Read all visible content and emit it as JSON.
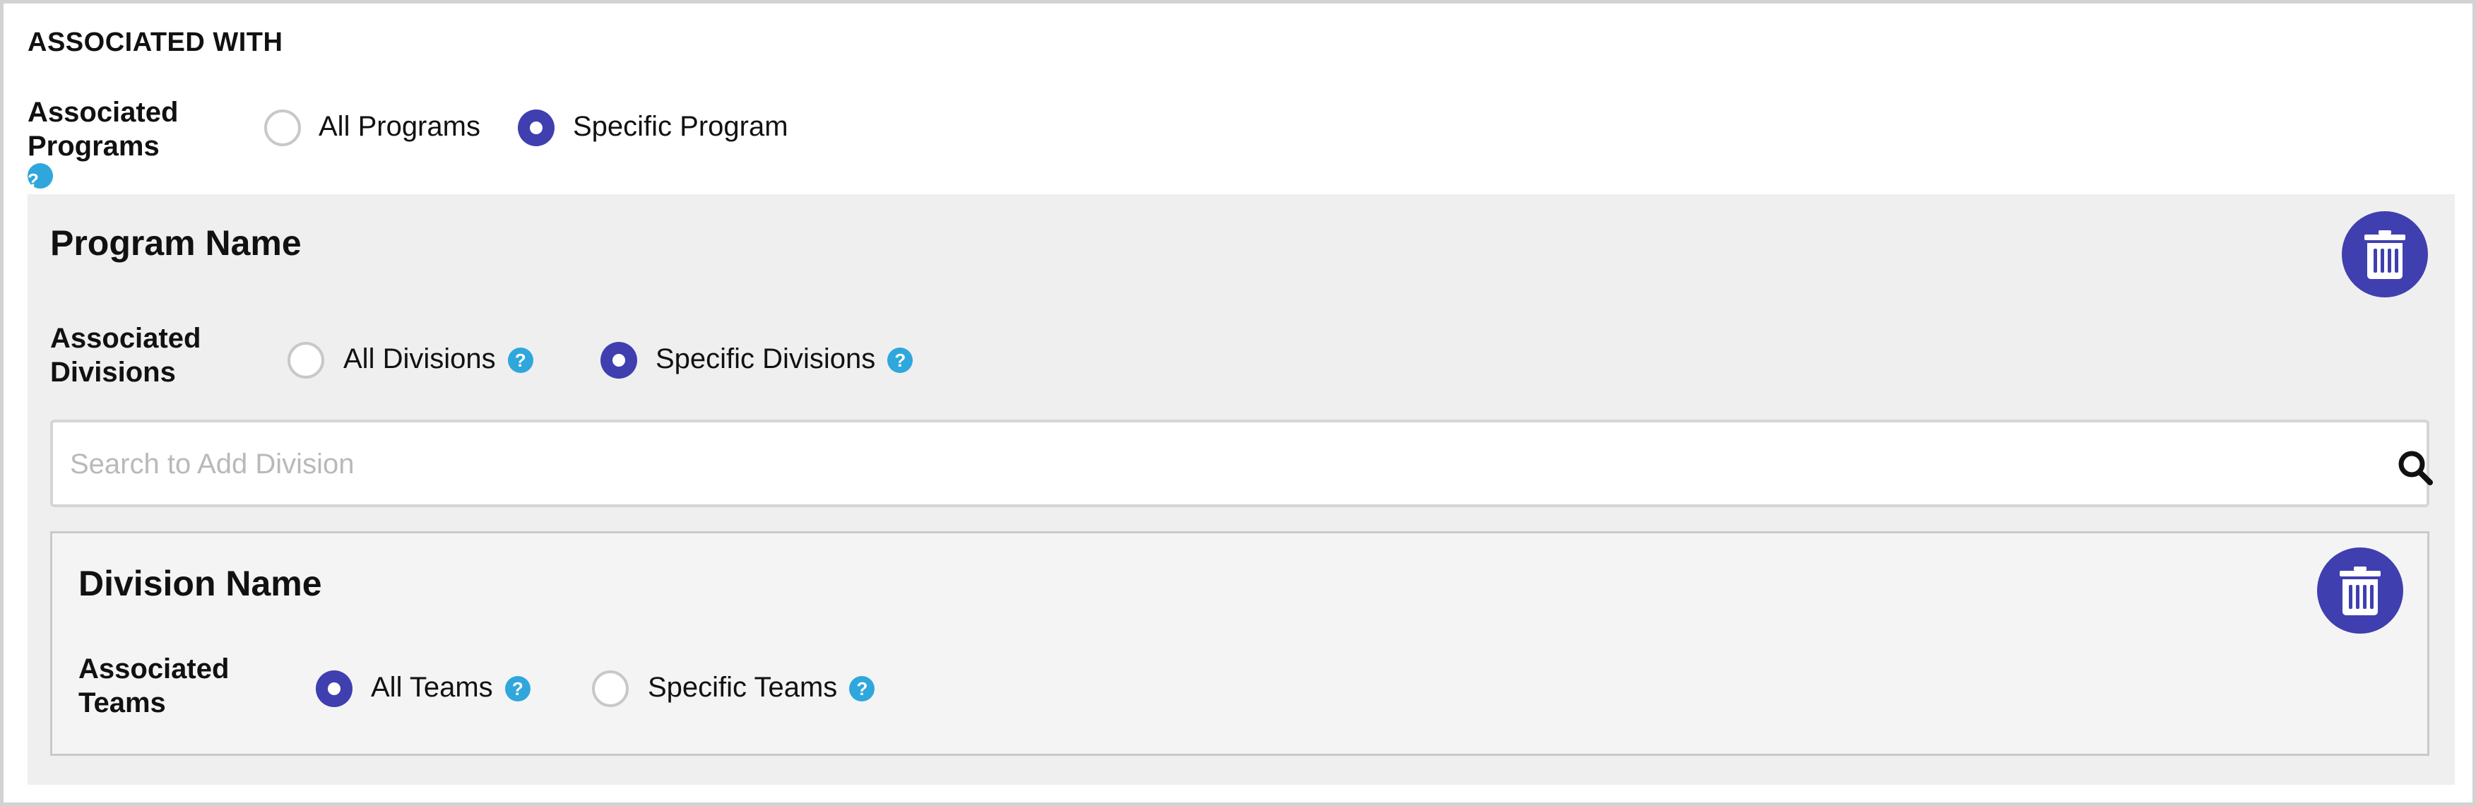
{
  "section": {
    "title": "ASSOCIATED WITH"
  },
  "programs": {
    "label_line1": "Associated",
    "label_line2": "Programs",
    "help_icon": "?",
    "options": [
      {
        "label": "All Programs",
        "selected": false
      },
      {
        "label": "Specific Program",
        "selected": true
      }
    ]
  },
  "program_panel": {
    "title": "Program Name",
    "delete_icon": "trash-icon",
    "divisions": {
      "label_line1": "Associated",
      "label_line2": "Divisions",
      "help_icon": "?",
      "options": [
        {
          "label": "All Divisions",
          "selected": false
        },
        {
          "label": "Specific Divisions",
          "selected": true
        }
      ]
    },
    "search": {
      "placeholder": "Search to Add Division",
      "value": "",
      "icon": "search-icon"
    }
  },
  "division_panel": {
    "title": "Division Name",
    "delete_icon": "trash-icon",
    "teams": {
      "label_line1": "Associated",
      "label_line2": "Teams",
      "help_icon": "?",
      "options": [
        {
          "label": "All Teams",
          "selected": true
        },
        {
          "label": "Specific Teams",
          "selected": false
        }
      ]
    }
  },
  "colors": {
    "accent": "#3f3fb0",
    "help": "#2fa7dc",
    "panel_bg": "#efefef",
    "subpanel_bg": "#f4f4f4"
  }
}
